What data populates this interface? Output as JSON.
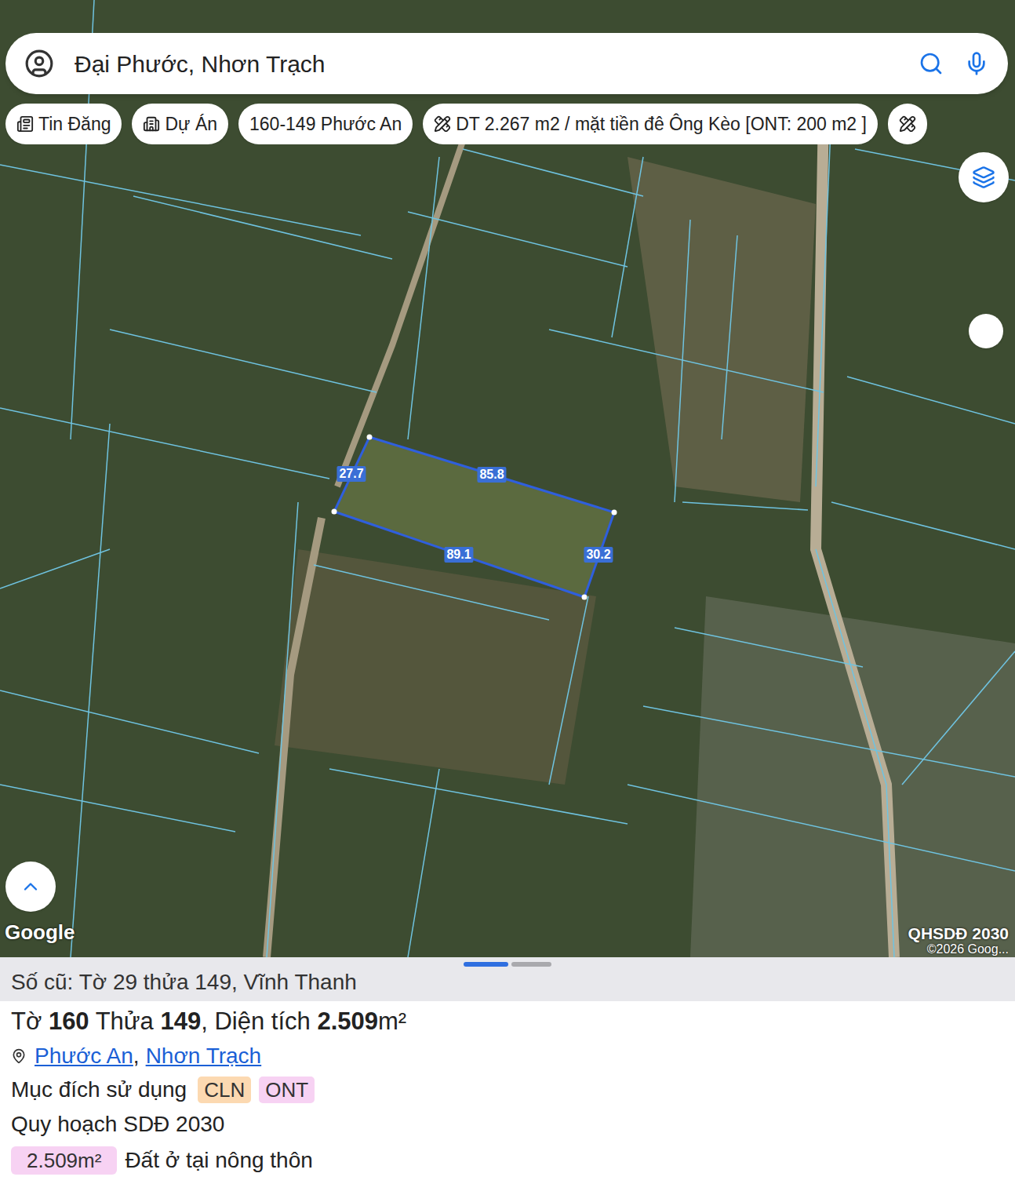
{
  "search": {
    "query": "Đại Phước, Nhơn Trạch"
  },
  "chips": [
    {
      "label": "Tin Đăng",
      "kind": "news"
    },
    {
      "label": "Dự Án",
      "kind": "building"
    },
    {
      "label": "160-149 Phước An",
      "kind": "plain"
    },
    {
      "label": "DT 2.267 m2 / mặt tiền đê Ông Kèo [ONT: 200 m2 ]",
      "kind": "tool"
    },
    {
      "kind": "tool-cut"
    }
  ],
  "parcel": {
    "edges": [
      "27.7",
      "85.8",
      "89.1",
      "30.2"
    ]
  },
  "map": {
    "attribution": "Google",
    "layer": "QHSDĐ 2030",
    "copyright": "©2026 Goog..."
  },
  "sheet": {
    "pages": [
      {
        "selected": true
      },
      {
        "selected": false
      }
    ],
    "old_number": "Số cũ: Tờ 29 thửa 149, Vĩnh Thanh",
    "title": [
      {
        "text": "Tờ ",
        "bold": false
      },
      {
        "text": "160",
        "bold": true
      },
      {
        "text": " Thửa ",
        "bold": false
      },
      {
        "text": "149",
        "bold": true
      },
      {
        "text": ", Diện tích ",
        "bold": false
      },
      {
        "text": "2.509",
        "bold": true
      },
      {
        "text": "m²",
        "bold": false
      }
    ],
    "location": {
      "links": [
        "Phước An",
        "Nhơn Trạch"
      ],
      "separator": ","
    },
    "usage": {
      "label": "Mục đích sử dụng",
      "tags": [
        {
          "label": "CLN",
          "color": "#fcd9b1"
        },
        {
          "label": "ONT",
          "color": "#f7d2f3"
        }
      ]
    },
    "plan": {
      "title": "Quy hoạch SDĐ 2030",
      "items": [
        {
          "area": "2.509m²",
          "label": "Đất ở tại nông thôn",
          "color": "#f7d2f3"
        }
      ]
    }
  }
}
